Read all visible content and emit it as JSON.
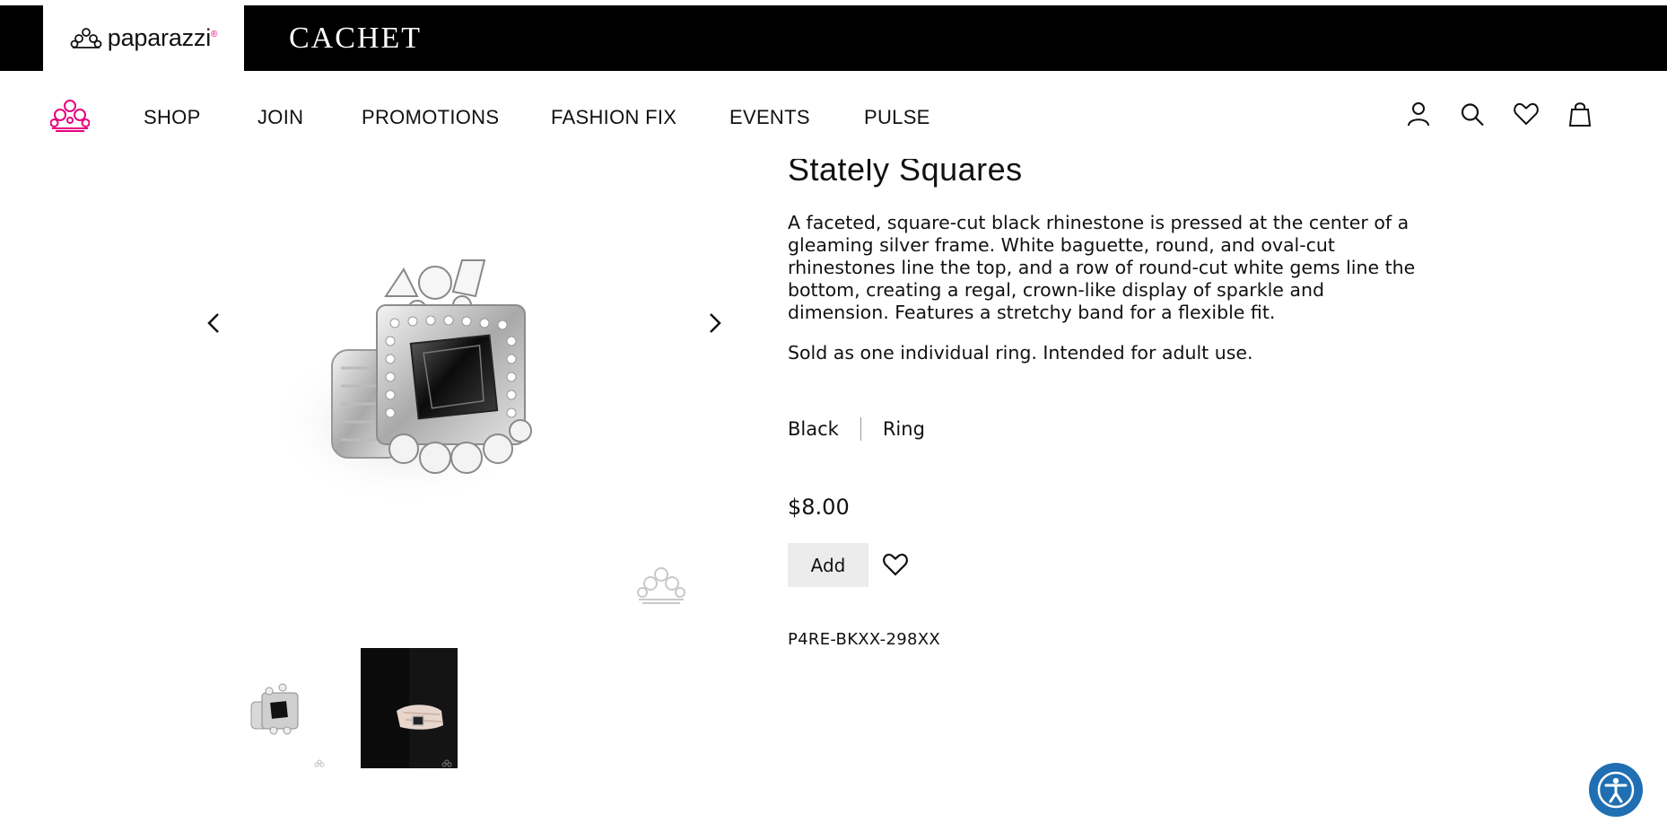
{
  "brand_bar": {
    "primary_brand": "paparazzi",
    "primary_brand_mark": "®",
    "secondary_brand": "CACHET"
  },
  "nav": {
    "logo_icon": "crown-logo-icon",
    "items": [
      "SHOP",
      "JOIN",
      "PROMOTIONS",
      "FASHION FIX",
      "EVENTS",
      "PULSE"
    ],
    "icons": [
      "account-icon",
      "search-icon",
      "heart-icon",
      "bag-icon"
    ]
  },
  "product": {
    "title": "Stately Squares",
    "description": "A faceted, square-cut black rhinestone is pressed at the center of a gleaming silver frame. White baguette, round, and oval-cut rhinestones line the top, and a row of round-cut white gems line the bottom, creating a regal, crown-like display of sparkle and dimension. Features a stretchy band for a flexible fit.",
    "note": "Sold as one individual ring. Intended for adult use.",
    "color": "Black",
    "category": "Ring",
    "price": "$8.00",
    "add_label": "Add",
    "sku": "P4RE-BKXX-298XX"
  },
  "gallery": {
    "prev_icon": "chevron-left-icon",
    "next_icon": "chevron-right-icon",
    "watermark_icon": "crown-watermark-icon",
    "thumbnails": [
      "ring-thumbnail",
      "ring-on-hand-thumbnail"
    ]
  },
  "accessibility": {
    "icon": "accessibility-icon",
    "color": "#1f6fb2"
  },
  "colors": {
    "brand_pink": "#e6007e",
    "bar_black": "#000000",
    "button_grey": "#ececec"
  }
}
